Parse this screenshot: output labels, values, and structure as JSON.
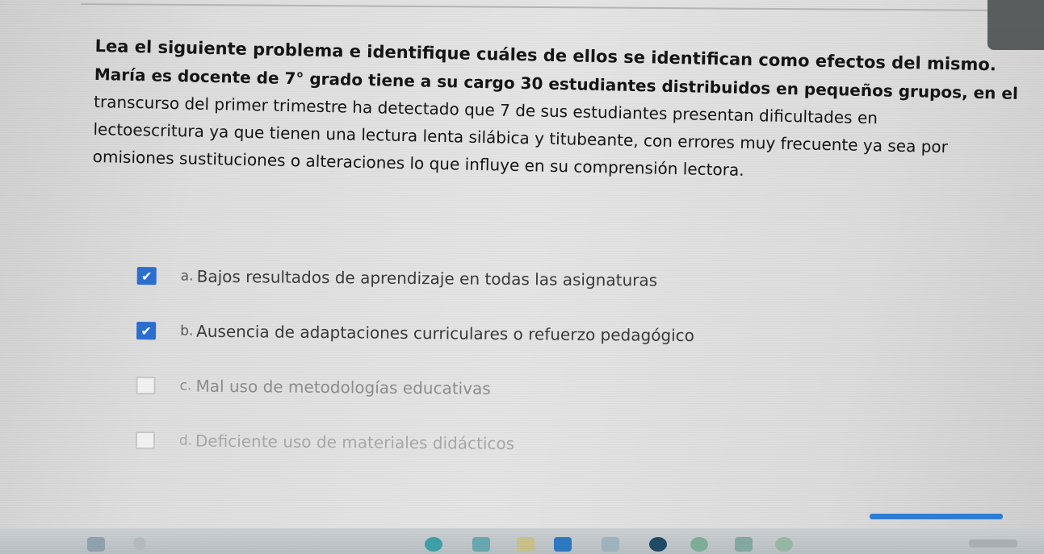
{
  "question": {
    "instruction": "Lea el siguiente problema e identifique cuáles de ellos se identifican como efectos del mismo.",
    "problem_lines": [
      "María es docente de  7° grado tiene a su cargo 30 estudiantes distribuidos en pequeños grupos, en el",
      "transcurso del primer trimestre ha detectado que 7 de sus estudiantes presentan dificultades en",
      "lectoescritura ya que tienen una lectura  lenta silábica y titubeante, con errores muy frecuente ya sea por",
      "omisiones sustituciones o alteraciones lo que influye en su comprensión lectora."
    ]
  },
  "options": [
    {
      "letter": "a.",
      "text": "Bajos resultados de aprendizaje en todas las asignaturas",
      "checked": true
    },
    {
      "letter": "b.",
      "text": "Ausencia de adaptaciones curriculares o refuerzo pedagógico",
      "checked": true
    },
    {
      "letter": "c.",
      "text": "Mal uso de metodologías educativas",
      "checked": false
    },
    {
      "letter": "d.",
      "text": "Deficiente uso de materiales didácticos",
      "checked": false
    }
  ],
  "colors": {
    "checkbox_checked": "#2c6fd1",
    "progress": "#2e7dd6"
  },
  "icons": {
    "check": "✔"
  }
}
